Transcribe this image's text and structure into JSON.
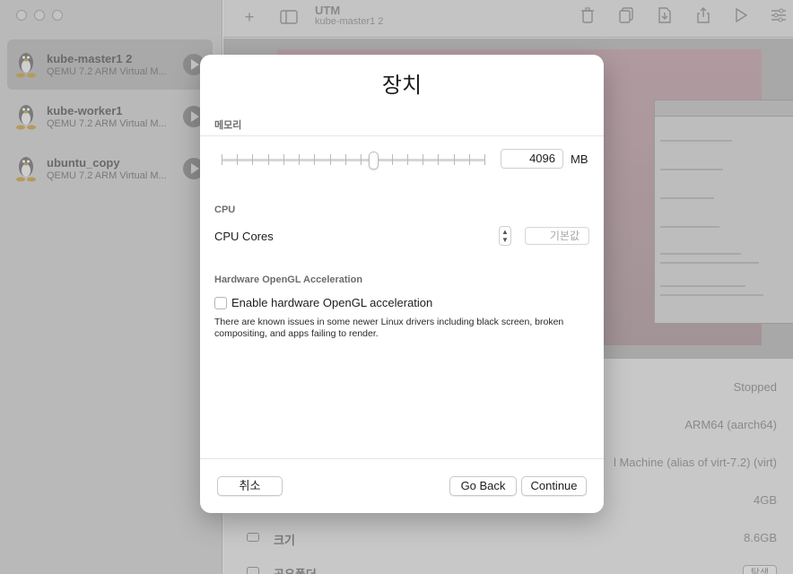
{
  "app": {
    "title": "UTM",
    "subtitle": "kube-master1 2"
  },
  "sidebar": {
    "items": [
      {
        "name": "kube-master1 2",
        "sub": "QEMU 7.2 ARM Virtual M...",
        "selected": true
      },
      {
        "name": "kube-worker1",
        "sub": "QEMU 7.2 ARM Virtual M...",
        "selected": false
      },
      {
        "name": "ubuntu_copy",
        "sub": "QEMU 7.2 ARM Virtual M...",
        "selected": false
      }
    ]
  },
  "details": {
    "status": "Stopped",
    "architecture": "ARM64 (aarch64)",
    "machine": "l Machine (alias of virt-7.2) (virt)",
    "memory": "4GB",
    "size_label": "크기",
    "size_value": "8.6GB",
    "shared_folder_label": "공유폴더",
    "shared_folder_button": "탐색"
  },
  "modal": {
    "title": "장치",
    "memory_section": "메모리",
    "memory_value": "4096",
    "memory_unit": "MB",
    "memory_slider_fraction": 0.58,
    "cpu_section": "CPU",
    "cpu_cores_label": "CPU Cores",
    "cpu_cores_placeholder": "기본값",
    "opengl_section": "Hardware OpenGL Acceleration",
    "opengl_checkbox_label": "Enable hardware OpenGL acceleration",
    "opengl_checked": false,
    "opengl_note": "There are known issues in some newer Linux drivers including black screen, broken compositing, and apps failing to render.",
    "cancel_label": "취소",
    "go_back_label": "Go Back",
    "continue_label": "Continue"
  }
}
